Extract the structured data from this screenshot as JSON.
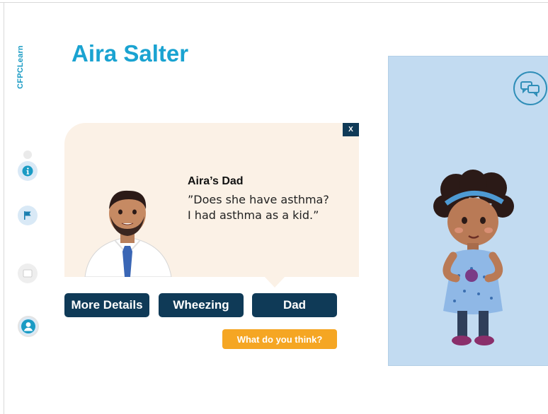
{
  "logo": {
    "text": "CFPCLearn"
  },
  "page": {
    "title": "Aira Salter"
  },
  "sidebar": {
    "items": [
      {
        "name": "info",
        "icon": "info-icon"
      },
      {
        "name": "flag",
        "icon": "flag-icon"
      },
      {
        "name": "notebook",
        "icon": "book-icon"
      },
      {
        "name": "profile",
        "icon": "person-icon"
      }
    ]
  },
  "dialog": {
    "close_label": "X",
    "speaker": "Aira’s Dad",
    "quote_line1": "”Does she have asthma?",
    "quote_line2": "I had asthma as a kid.”"
  },
  "nav": {
    "more_details": "More Details",
    "wheezing": "Wheezing",
    "dad": "Dad"
  },
  "cta": {
    "label": "What do you think?"
  },
  "colors": {
    "accent": "#1aa3d1",
    "navy": "#0f3a57",
    "orange": "#f5a623",
    "panel": "#c2dbf1",
    "bubble": "#fbf1e6"
  }
}
